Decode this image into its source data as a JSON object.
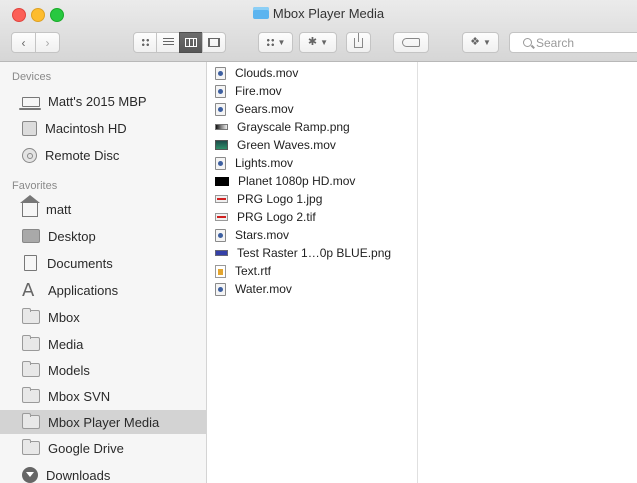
{
  "window": {
    "title": "Mbox Player Media"
  },
  "toolbar": {
    "back_label": "‹",
    "forward_label": "›",
    "view_modes": [
      "icon",
      "list",
      "column",
      "cover-flow"
    ],
    "active_view": "column",
    "search_placeholder": "Search"
  },
  "sidebar": {
    "devices_header": "Devices",
    "devices": [
      {
        "label": "Matt's 2015 MBP",
        "icon": "laptop-icon"
      },
      {
        "label": "Macintosh HD",
        "icon": "hard-drive-icon"
      },
      {
        "label": "Remote Disc",
        "icon": "disc-icon"
      }
    ],
    "favorites_header": "Favorites",
    "favorites": [
      {
        "label": "matt",
        "icon": "home-icon"
      },
      {
        "label": "Desktop",
        "icon": "desktop-icon"
      },
      {
        "label": "Documents",
        "icon": "documents-icon"
      },
      {
        "label": "Applications",
        "icon": "applications-icon"
      },
      {
        "label": "Mbox",
        "icon": "folder-icon"
      },
      {
        "label": "Media",
        "icon": "folder-icon"
      },
      {
        "label": "Models",
        "icon": "folder-icon"
      },
      {
        "label": "Mbox SVN",
        "icon": "folder-icon"
      },
      {
        "label": "Mbox Player Media",
        "icon": "folder-icon",
        "selected": true
      },
      {
        "label": "Google Drive",
        "icon": "folder-icon"
      },
      {
        "label": "Downloads",
        "icon": "downloads-icon"
      }
    ]
  },
  "files": [
    {
      "name": "Clouds.mov",
      "type": "mov"
    },
    {
      "name": "Fire.mov",
      "type": "mov"
    },
    {
      "name": "Gears.mov",
      "type": "mov"
    },
    {
      "name": "Grayscale Ramp.png",
      "type": "png"
    },
    {
      "name": "Green Waves.mov",
      "type": "green"
    },
    {
      "name": "Lights.mov",
      "type": "mov"
    },
    {
      "name": "Planet 1080p HD.mov",
      "type": "black"
    },
    {
      "name": "PRG Logo 1.jpg",
      "type": "prg"
    },
    {
      "name": "PRG Logo 2.tif",
      "type": "prg"
    },
    {
      "name": "Stars.mov",
      "type": "mov"
    },
    {
      "name": "Test Raster 1…0p BLUE.png",
      "type": "blue"
    },
    {
      "name": "Text.rtf",
      "type": "rtf"
    },
    {
      "name": "Water.mov",
      "type": "mov"
    }
  ]
}
